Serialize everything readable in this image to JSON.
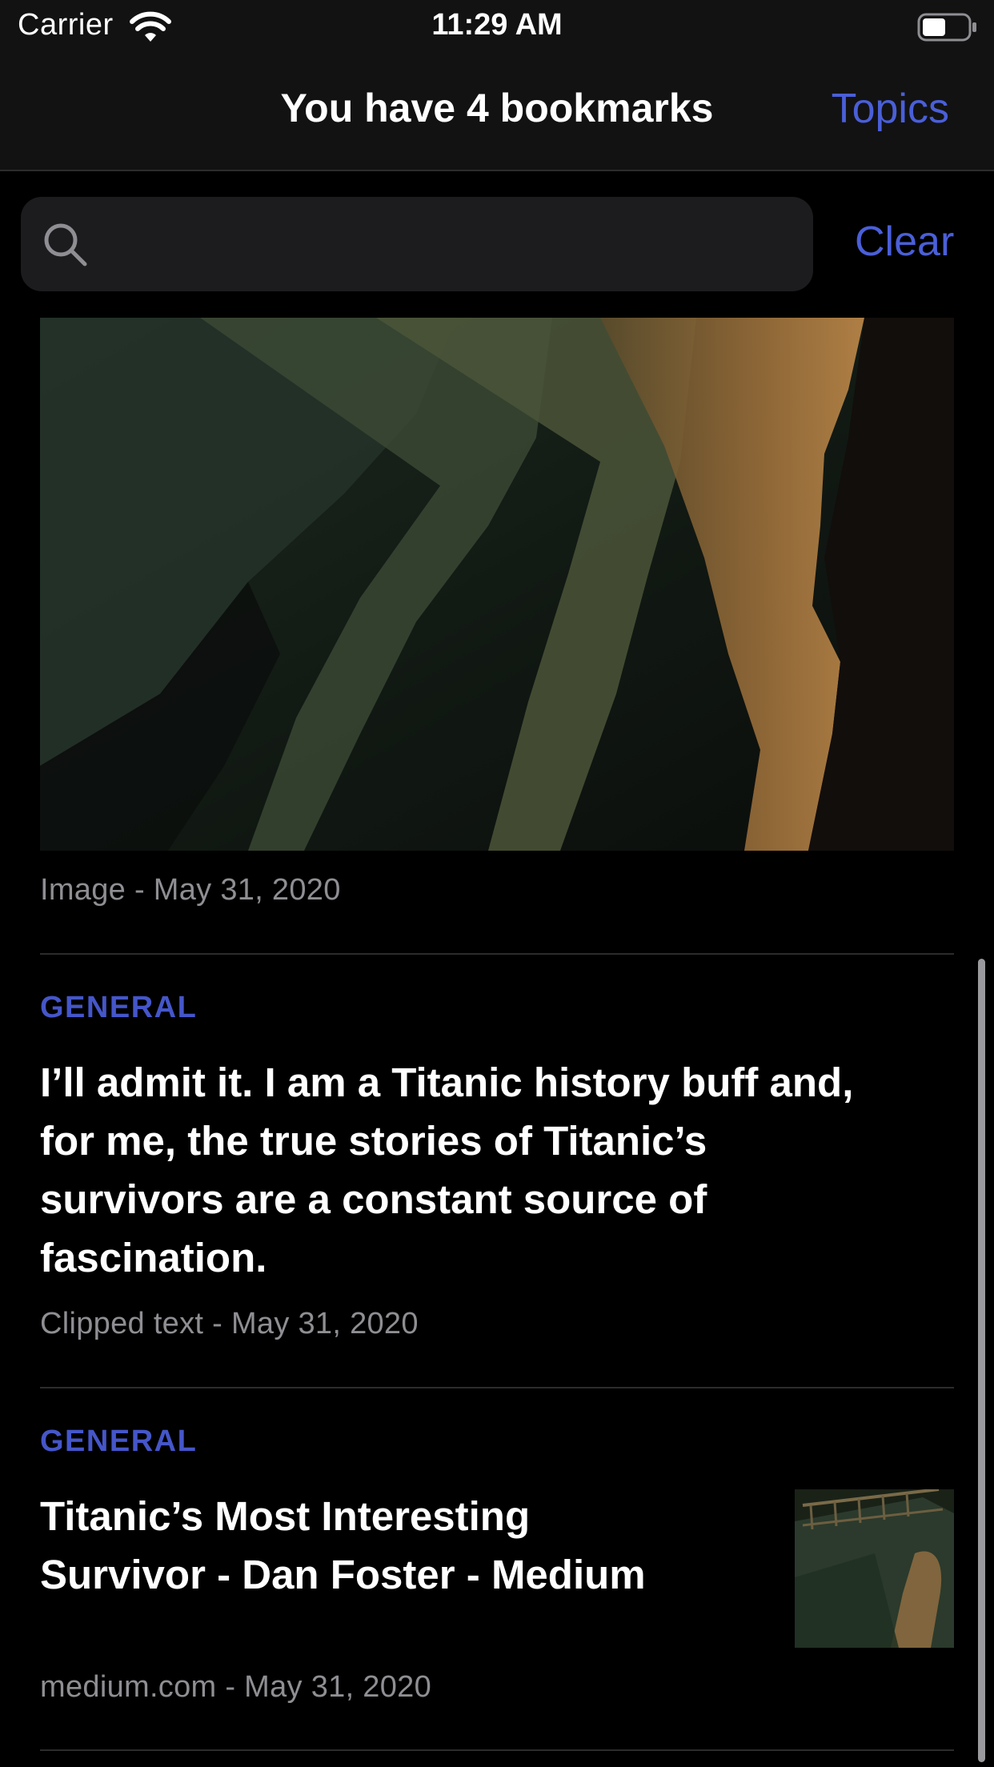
{
  "status_bar": {
    "carrier": "Carrier",
    "time": "11:29 AM"
  },
  "nav": {
    "title": "You have 4 bookmarks",
    "topics_label": "Topics"
  },
  "search": {
    "placeholder": "",
    "value": "",
    "clear_label": "Clear"
  },
  "items": [
    {
      "type": "image",
      "meta": "Image - May 31, 2020"
    },
    {
      "category": "GENERAL",
      "text_lines": [
        "I’ll admit it. I am a Titanic history buff and,",
        "for me, the true stories of Titanic’s",
        "survivors are a constant source of",
        "fascination."
      ],
      "meta": "Clipped text - May 31, 2020"
    },
    {
      "category": "GENERAL",
      "title_lines": [
        "Titanic’s Most Interesting",
        "Survivor - Dan Foster - Medium"
      ],
      "meta": "medium.com - May 31, 2020"
    }
  ],
  "colors": {
    "accent": "#4a5fd8",
    "category": "#4556c9",
    "meta_text": "#8e8e93",
    "background": "#000000",
    "bar_background": "#121212",
    "search_background": "#1c1c1e",
    "divider": "#2c2c2e"
  },
  "icons": {
    "wifi": "wifi-icon",
    "battery": "battery-icon",
    "search": "search-icon"
  }
}
